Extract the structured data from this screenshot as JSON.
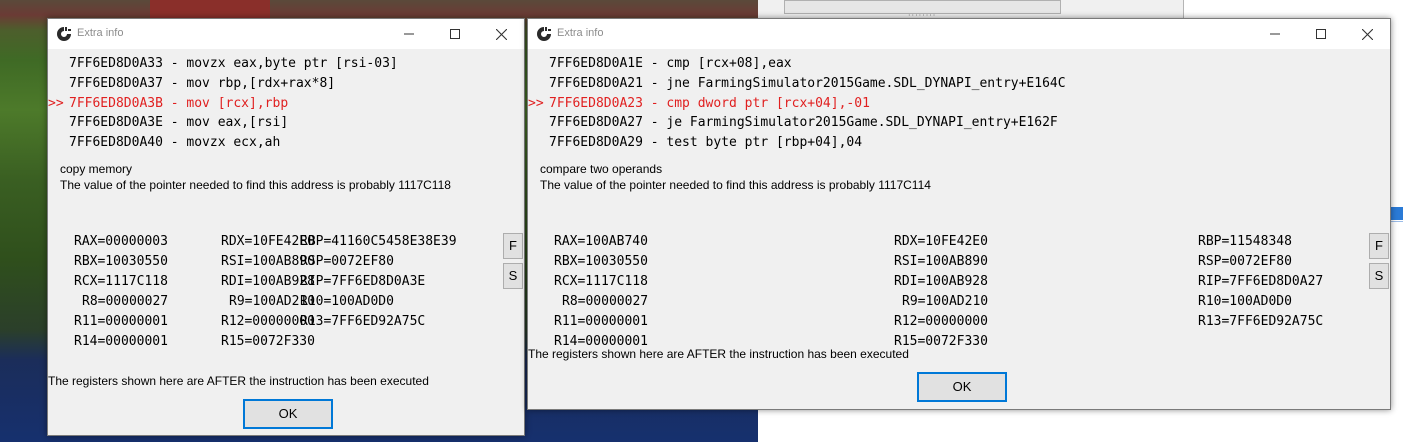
{
  "dialogs": [
    {
      "title": "Extra info",
      "marker": ">>",
      "asm": [
        "7FF6ED8D0A33 - movzx eax,byte ptr [rsi-03]",
        "7FF6ED8D0A37 - mov rbp,[rdx+rax*8]",
        "7FF6ED8D0A3B - mov [rcx],rbp",
        "7FF6ED8D0A3E - mov eax,[rsi]",
        "7FF6ED8D0A40 - movzx ecx,ah"
      ],
      "description": "copy memory",
      "pointer_text": "The value of the pointer needed to find this address is probably 1117C118",
      "registers": {
        "RAX": "RAX=00000003",
        "RBX": "RBX=10030550",
        "RCX": "RCX=1117C118",
        "R8": "R8=00000027",
        "R11": "R11=00000001",
        "R14": "R14=00000001",
        "RDX": "RDX=10FE42E0",
        "RSI": "RSI=100AB890",
        "RDI": "RDI=100AB928",
        "R9": "R9=100AD210",
        "R12": "R12=00000000",
        "R15": "R15=0072F330",
        "RBP": "RBP=41160C5458E38E39",
        "RSP": "RSP=0072EF80",
        "RIP": "RIP=7FF6ED8D0A3E",
        "R10": "R10=100AD0D0",
        "R13": "R13=7FF6ED92A75C"
      },
      "float_button": "F",
      "stack_button": "S",
      "after_text": "The registers shown here are AFTER the instruction has been executed",
      "ok_label": "OK"
    },
    {
      "title": "Extra info",
      "marker": ">>",
      "asm": [
        "7FF6ED8D0A1E - cmp [rcx+08],eax",
        "7FF6ED8D0A21 - jne FarmingSimulator2015Game.SDL_DYNAPI_entry+E164C",
        "7FF6ED8D0A23 - cmp dword ptr [rcx+04],-01",
        "7FF6ED8D0A27 - je FarmingSimulator2015Game.SDL_DYNAPI_entry+E162F",
        "7FF6ED8D0A29 - test byte ptr [rbp+04],04"
      ],
      "description": "compare two operands",
      "pointer_text": "The value of the pointer needed to find this address is probably 1117C114",
      "registers": {
        "RAX": "RAX=100AB740",
        "RBX": "RBX=10030550",
        "RCX": "RCX=1117C118",
        "R8": "R8=00000027",
        "R11": "R11=00000001",
        "R14": "R14=00000001",
        "RDX": "RDX=10FE42E0",
        "RSI": "RSI=100AB890",
        "RDI": "RDI=100AB928",
        "R9": "R9=100AD210",
        "R12": "R12=00000000",
        "R15": "R15=0072F330",
        "RBP": "RBP=11548348",
        "RSP": "RSP=0072EF80",
        "RIP": "RIP=7FF6ED8D0A27",
        "R10": "R10=100AD0D0",
        "R13": "R13=7FF6ED92A75C"
      },
      "float_button": "F",
      "stack_button": "S",
      "after_text": "The registers shown here are AFTER the instruction has been executed",
      "ok_label": "OK"
    }
  ],
  "background": {
    "grip": "········"
  },
  "icons": {
    "app": "cheat-engine-icon",
    "minimize": "minimize-icon",
    "maximize": "maximize-icon",
    "close": "close-icon"
  }
}
